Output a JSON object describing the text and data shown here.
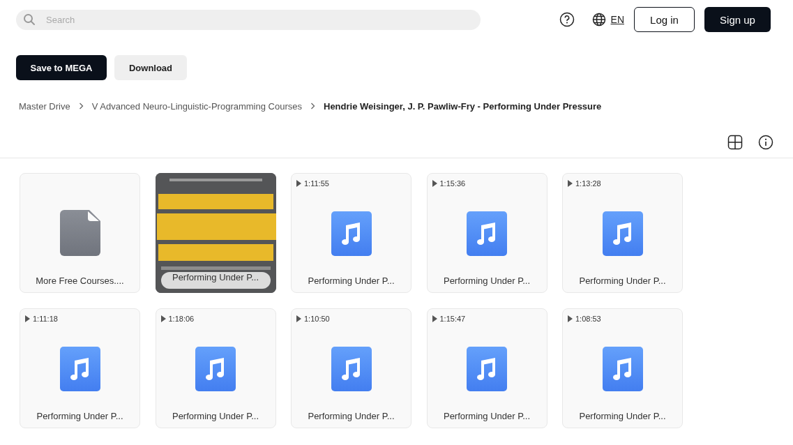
{
  "header": {
    "search": {
      "placeholder": "Search"
    },
    "language": "EN",
    "login": "Log in",
    "signup": "Sign up"
  },
  "actions": [
    "Save to MEGA",
    "Download"
  ],
  "breadcrumb": [
    "Master Drive",
    "V Advanced Neuro-Linguistic-Programming Courses",
    "Hendrie Weisinger, J. P. Pawliw-Fry - Performing Under Pressure"
  ],
  "files": [
    {
      "kind": "file",
      "name": "More Free Courses...."
    },
    {
      "kind": "picture",
      "name": "Performing Under P..."
    },
    {
      "kind": "audio",
      "duration": "1:11:55",
      "name": "Performing Under P..."
    },
    {
      "kind": "audio",
      "duration": "1:15:36",
      "name": "Performing Under P..."
    },
    {
      "kind": "audio",
      "duration": "1:13:28",
      "name": "Performing Under P..."
    },
    {
      "kind": "audio",
      "duration": "1:11:18",
      "name": "Performing Under P..."
    },
    {
      "kind": "audio",
      "duration": "1:18:06",
      "name": "Performing Under P..."
    },
    {
      "kind": "audio",
      "duration": "1:10:50",
      "name": "Performing Under P..."
    },
    {
      "kind": "audio",
      "duration": "1:15:47",
      "name": "Performing Under P..."
    },
    {
      "kind": "audio",
      "duration": "1:08:53",
      "name": "Performing Under P..."
    }
  ]
}
